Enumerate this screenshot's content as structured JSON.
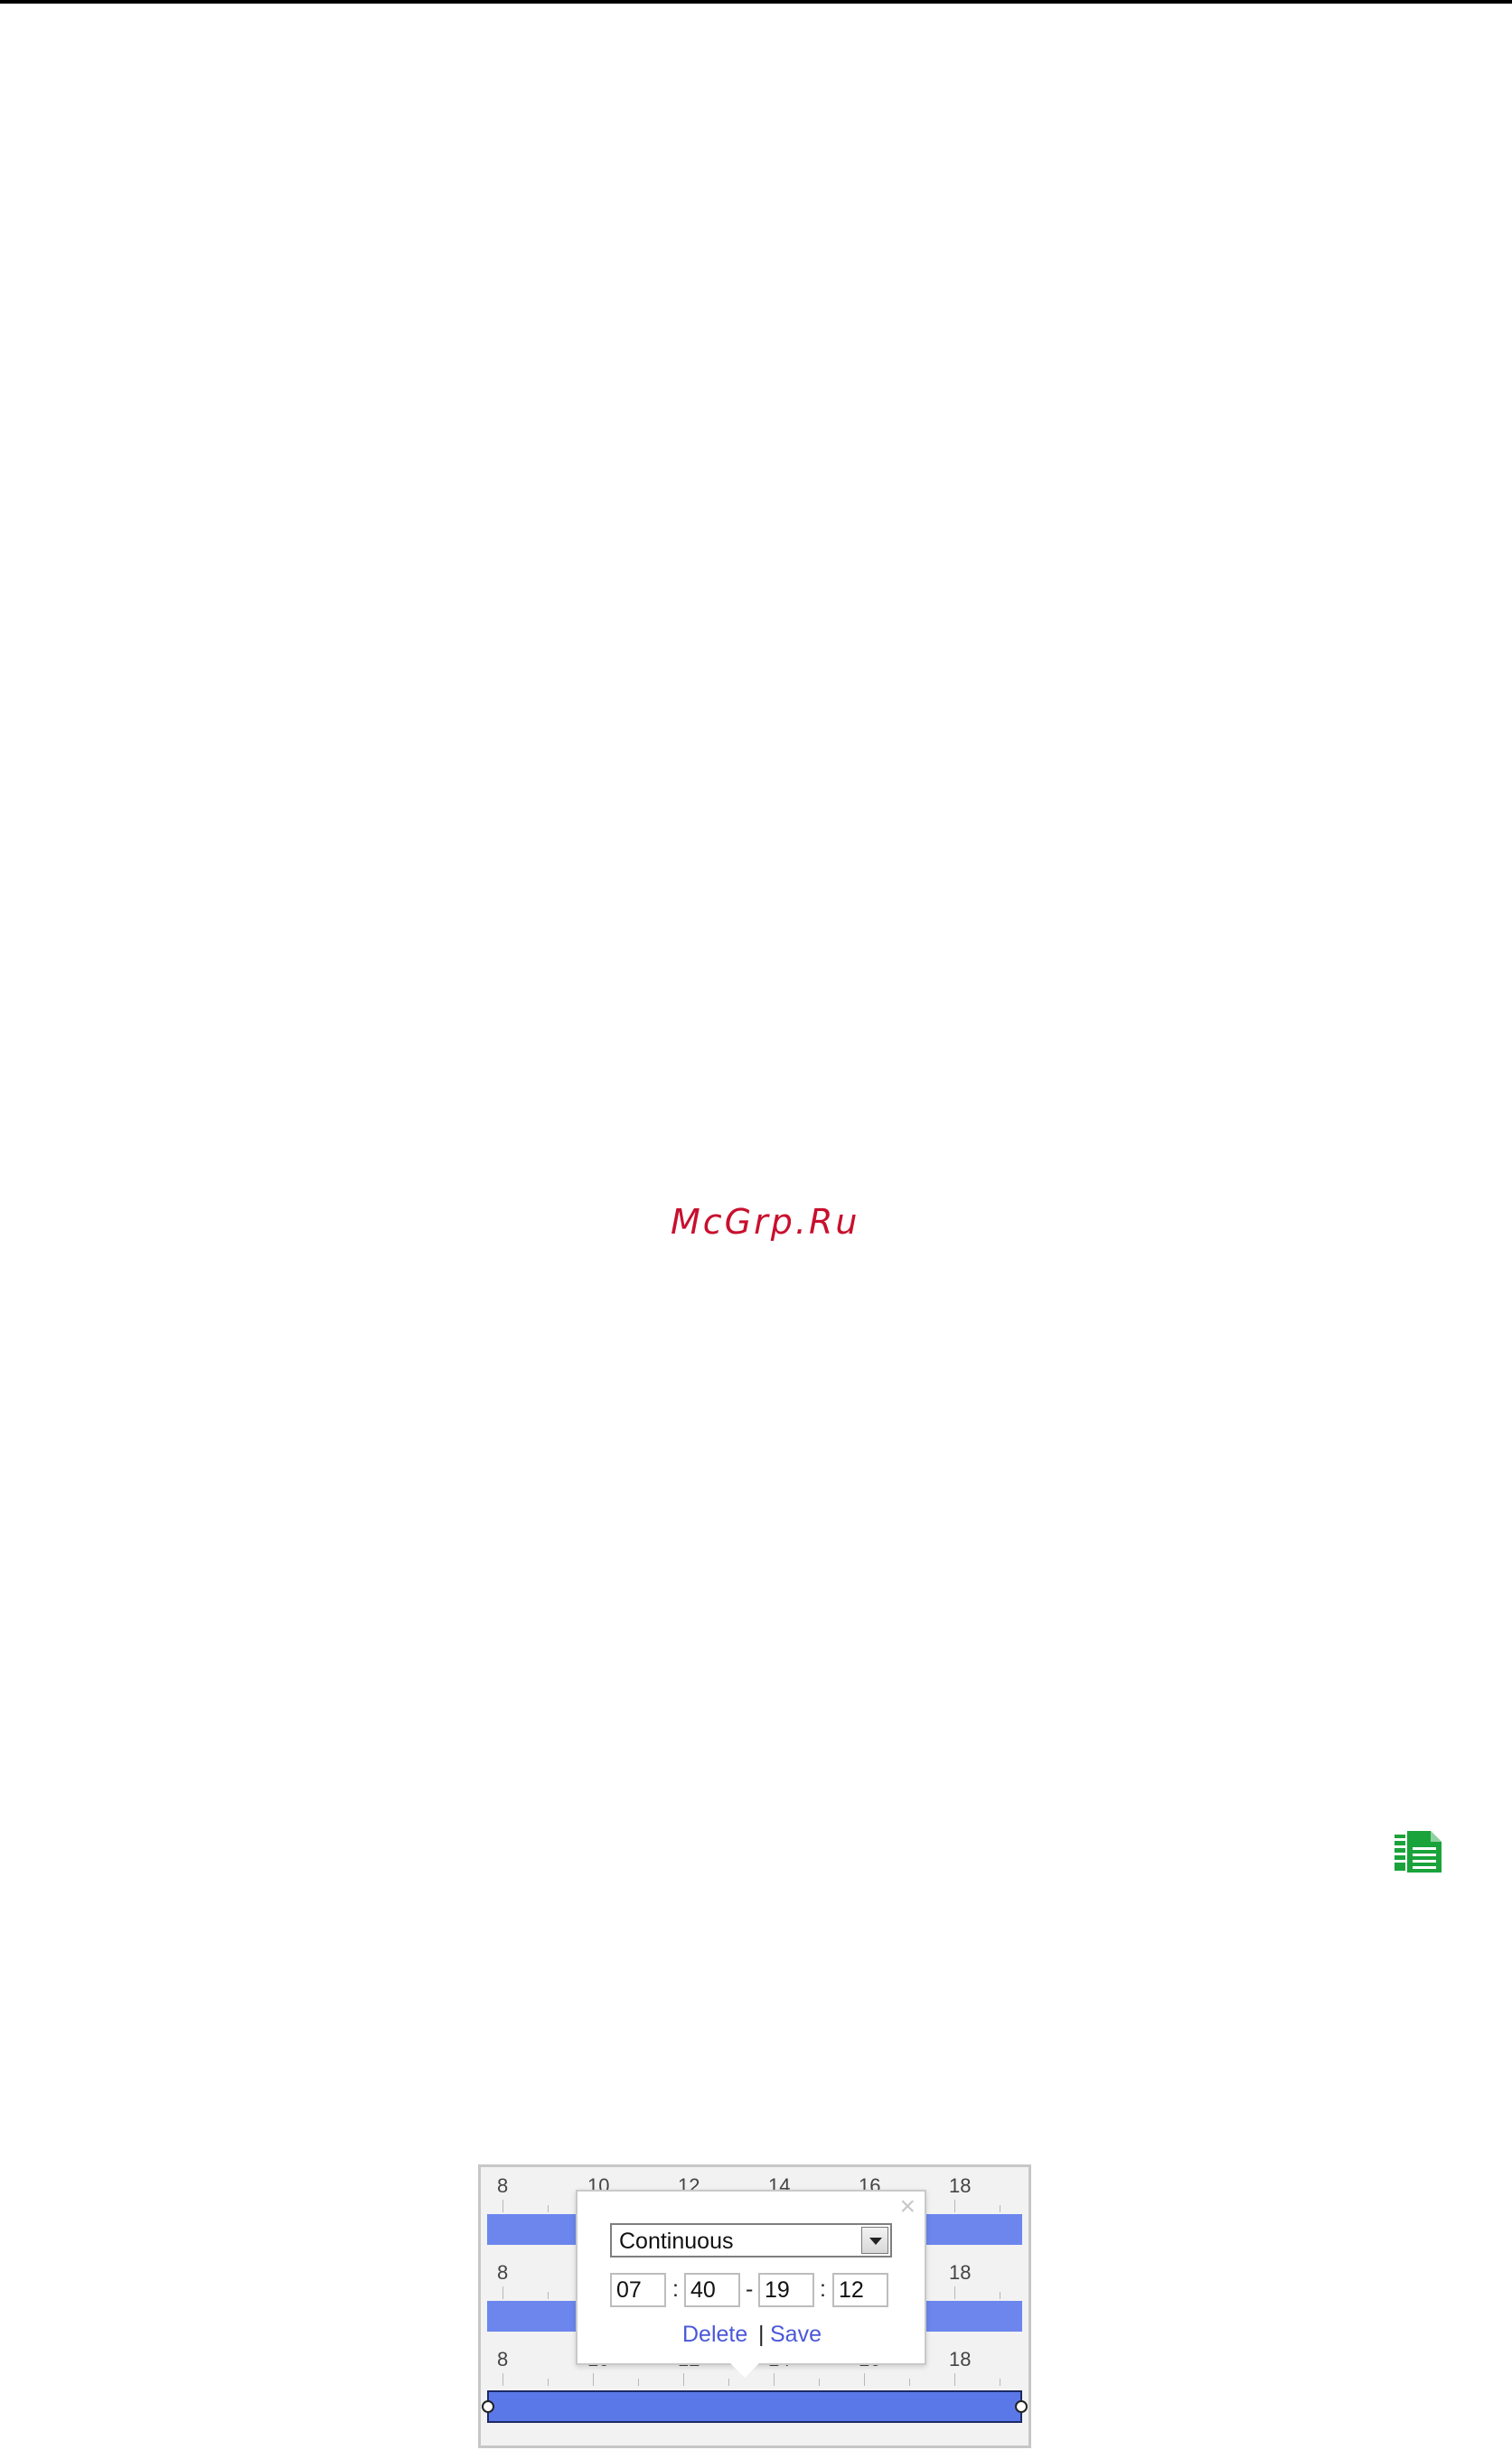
{
  "watermark": {
    "text": "McGrp.Ru",
    "color": "#c8102e"
  },
  "toolbar": {
    "copy_icon": "copy-icon",
    "copy_icon_color": "#1aa33a"
  },
  "schedule": {
    "ruler_labels": [
      "8",
      "10",
      "12",
      "14",
      "16",
      "18"
    ],
    "bar_color": "#6c86ee",
    "popup": {
      "close_glyph": "×",
      "mode": "Continuous",
      "start_hour": "07",
      "start_minute": "40",
      "end_hour": "19",
      "end_minute": "12",
      "colon": ":",
      "dash": "-",
      "delete_label": "Delete",
      "save_label": "Save",
      "divider": "|"
    }
  }
}
